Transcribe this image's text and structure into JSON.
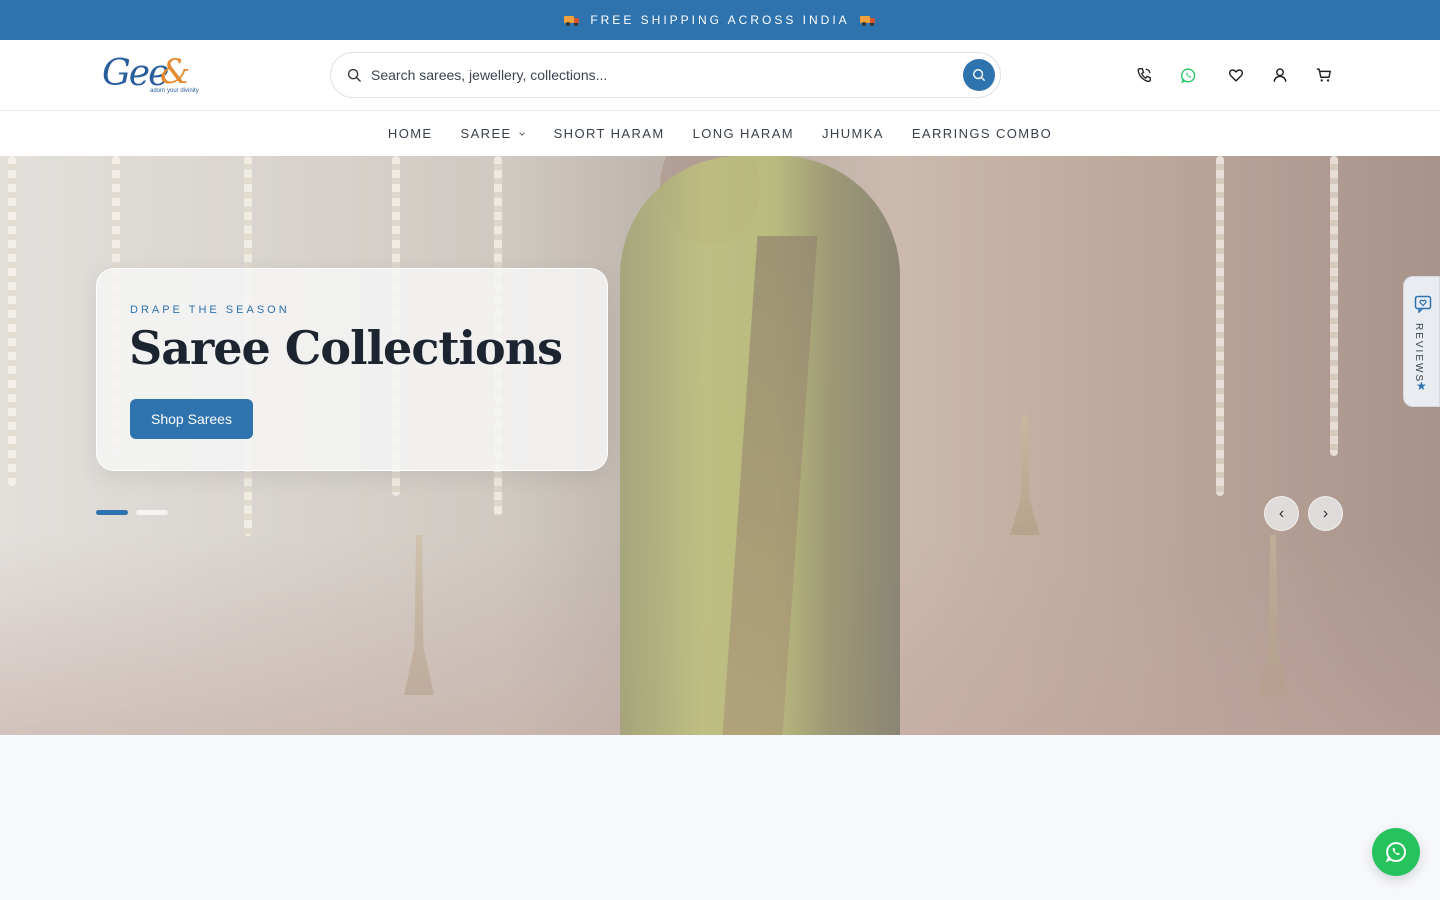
{
  "announcement": {
    "text": "FREE SHIPPING ACROSS INDIA",
    "icon": "truck-icon"
  },
  "brand": {
    "logo_word": "Gee",
    "logo_mark": "&",
    "tagline": "adorn your divinity",
    "color": "#2a5d9c",
    "accent": "#e58a2e"
  },
  "search": {
    "placeholder": "Search sarees, jewellery, collections..."
  },
  "header_icons": [
    "phone-icon",
    "whatsapp-icon",
    "heart-icon",
    "user-icon",
    "cart-icon"
  ],
  "nav": {
    "items": [
      {
        "label": "HOME"
      },
      {
        "label": "SAREE",
        "has_dropdown": true
      },
      {
        "label": "SHORT HARAM"
      },
      {
        "label": "LONG HARAM"
      },
      {
        "label": "JHUMKA"
      },
      {
        "label": "EARRINGS COMBO"
      }
    ]
  },
  "hero": {
    "eyebrow": "DRAPE THE SEASON",
    "title": "Saree Collections",
    "cta": "Shop Sarees",
    "slides_total": 2,
    "active_slide": 1,
    "prev": "‹",
    "next": "›"
  },
  "reviews_tab": {
    "label": "REVIEWS"
  },
  "colors": {
    "primary": "#2e72ae",
    "whatsapp": "#25c25e",
    "page_bg": "#f7f8fb"
  }
}
